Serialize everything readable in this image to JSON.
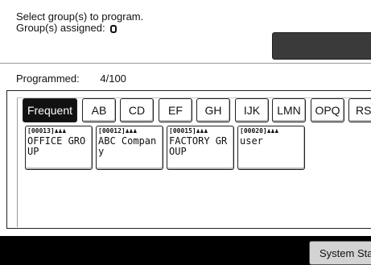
{
  "instruction": "Select group(s) to program.",
  "assigned": {
    "label": "Group(s) assigned:",
    "value": "0"
  },
  "programmed": {
    "label": "Programmed:",
    "value": "4/100"
  },
  "tabs": [
    {
      "label": "Frequent",
      "active": true
    },
    {
      "label": "AB"
    },
    {
      "label": "CD"
    },
    {
      "label": "EF"
    },
    {
      "label": "GH"
    },
    {
      "label": "IJK"
    },
    {
      "label": "LMN"
    },
    {
      "label": "OPQ"
    },
    {
      "label": "RST"
    }
  ],
  "groups": [
    {
      "id": "[00013]",
      "name": "OFFICE GROUP",
      "icon": "group-people-icon"
    },
    {
      "id": "[00012]",
      "name": "ABC Company",
      "icon": "group-people-icon"
    },
    {
      "id": "[00015]",
      "name": "FACTORY GROUP",
      "icon": "group-people-icon"
    },
    {
      "id": "[00020]",
      "name": "user",
      "icon": "group-people-icon"
    }
  ],
  "footer": {
    "status_button": "System Status"
  }
}
